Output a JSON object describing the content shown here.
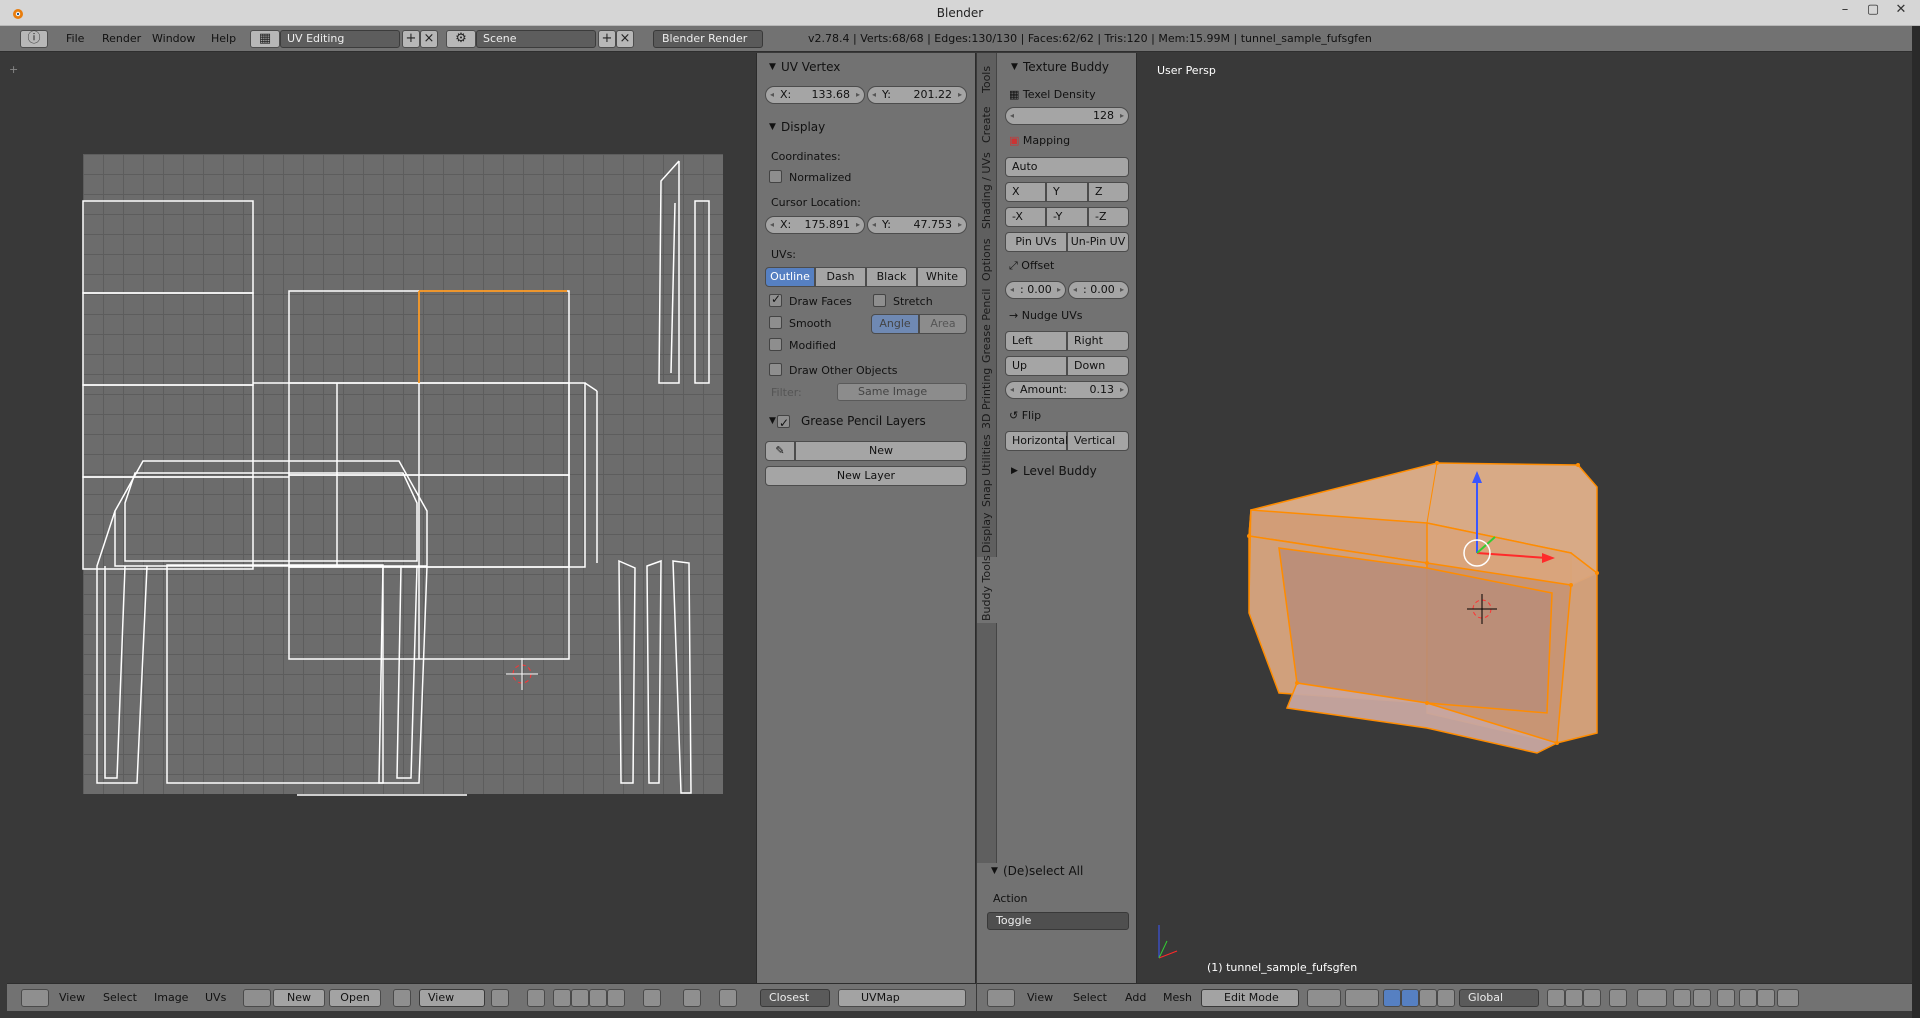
{
  "window": {
    "title": "Blender"
  },
  "infobar": {
    "menus": [
      "File",
      "Render",
      "Window",
      "Help"
    ],
    "layout": "UV Editing",
    "scene": "Scene",
    "engine": "Blender Render",
    "stats": "v2.78.4 | Verts:68/68 | Edges:130/130 | Faces:62/62 | Tris:120 | Mem:15.99M | tunnel_sample_fufsgfen"
  },
  "uv_panel": {
    "uv_vertex": {
      "title": "UV Vertex",
      "x_label": "X:",
      "x": "133.68",
      "y_label": "Y:",
      "y": "201.22"
    },
    "display": {
      "title": "Display",
      "coordinates": "Coordinates:",
      "normalized": "Normalized",
      "cursor_location": "Cursor Location:",
      "cx_label": "X:",
      "cx": "175.891",
      "cy_label": "Y:",
      "cy": "47.753",
      "uvs": "UVs:",
      "uv_modes": [
        "Outline",
        "Dash",
        "Black",
        "White"
      ],
      "draw_faces": "Draw Faces",
      "stretch": "Stretch",
      "smooth": "Smooth",
      "angle": "Angle",
      "area": "Area",
      "modified": "Modified",
      "draw_other": "Draw Other Objects",
      "filter_label": "Filter:",
      "filter_value": "Same Image"
    },
    "grease": {
      "title": "Grease Pencil Layers",
      "new": "New",
      "new_layer": "New Layer"
    }
  },
  "tool_tabs": [
    "Tools",
    "Create",
    "Shading / UVs",
    "Options",
    "Grease Pencil",
    "3D Printing",
    "Snap Utilities",
    "Display",
    "Buddy Tools"
  ],
  "texture_buddy": {
    "title": "Texture Buddy",
    "texel_density": "Texel Density",
    "texel_value": "128",
    "mapping": "Mapping",
    "auto": "Auto",
    "axes": [
      "X",
      "Y",
      "Z"
    ],
    "neg_axes": [
      "-X",
      "-Y",
      "-Z"
    ],
    "pin": "Pin UVs",
    "unpin": "Un-Pin UV",
    "offset": "Offset",
    "offset_a": ": 0.00",
    "offset_b": ": 0.00",
    "nudge": "Nudge UVs",
    "left": "Left",
    "right": "Right",
    "up": "Up",
    "down": "Down",
    "amount_label": "Amount:",
    "amount": "0.13",
    "flip": "Flip",
    "horizontal": "Horizontal",
    "vertical": "Vertical",
    "level_buddy": "Level Buddy"
  },
  "operator": {
    "title": "(De)select All",
    "action_label": "Action",
    "action_value": "Toggle"
  },
  "view3d": {
    "label": "User Persp",
    "object": "(1) tunnel_sample_fufsgfen"
  },
  "uv_footer": {
    "menus": [
      "View",
      "Select",
      "Image",
      "UVs"
    ],
    "new": "New",
    "open": "Open",
    "view": "View",
    "snap": "Closest",
    "uvmap": "UVMap"
  },
  "v3d_footer": {
    "menus": [
      "View",
      "Select",
      "Add",
      "Mesh"
    ],
    "mode": "Edit Mode",
    "orientation": "Global"
  },
  "colors": {
    "selection": "#ff8c00",
    "highlight_button": "#5680c2"
  }
}
